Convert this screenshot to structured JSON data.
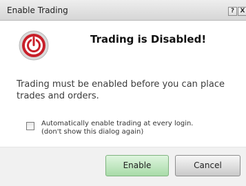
{
  "window": {
    "title": "Enable Trading",
    "help_glyph": "?",
    "close_glyph": "X"
  },
  "icon": {
    "name": "power-icon",
    "color_ring": "#c8202a",
    "color_ring_outer": "#b9b9b9"
  },
  "dialog": {
    "heading": "Trading is Disabled!",
    "message": "Trading must be enabled before you can place trades and orders.",
    "checkbox": {
      "checked": false,
      "label_line1": "Automatically enable trading at every login.",
      "label_line2": "(don't show this dialog again)"
    }
  },
  "buttons": {
    "enable_label": "Enable",
    "cancel_label": "Cancel",
    "enable_color": "#a8dba8",
    "cancel_color": "#c9c9c9"
  }
}
